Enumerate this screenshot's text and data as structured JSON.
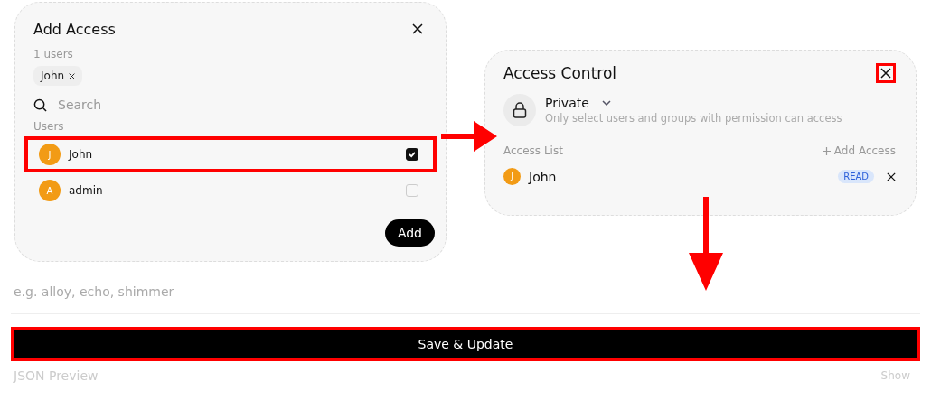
{
  "add_access": {
    "title": "Add Access",
    "count": "1 users",
    "chips": [
      {
        "label": "John"
      }
    ],
    "search": {
      "placeholder": "Search"
    },
    "section": "Users",
    "users": [
      {
        "initial": "J",
        "name": "John",
        "checked": true,
        "highlighted": true
      },
      {
        "initial": "A",
        "name": "admin",
        "checked": false,
        "highlighted": false
      }
    ],
    "add_button": "Add"
  },
  "access_control": {
    "title": "Access Control",
    "close_highlighted": true,
    "visibility": {
      "label": "Private",
      "description": "Only select users and groups with permission can access"
    },
    "list_label": "Access List",
    "add_label": "Add Access",
    "entries": [
      {
        "initial": "J",
        "name": "John",
        "permission": "READ"
      }
    ]
  },
  "form": {
    "voice": {
      "placeholder": "e.g. alloy, echo, shimmer"
    },
    "save_button": "Save & Update",
    "save_highlighted": true,
    "json_preview": "JSON Preview",
    "show": "Show"
  }
}
